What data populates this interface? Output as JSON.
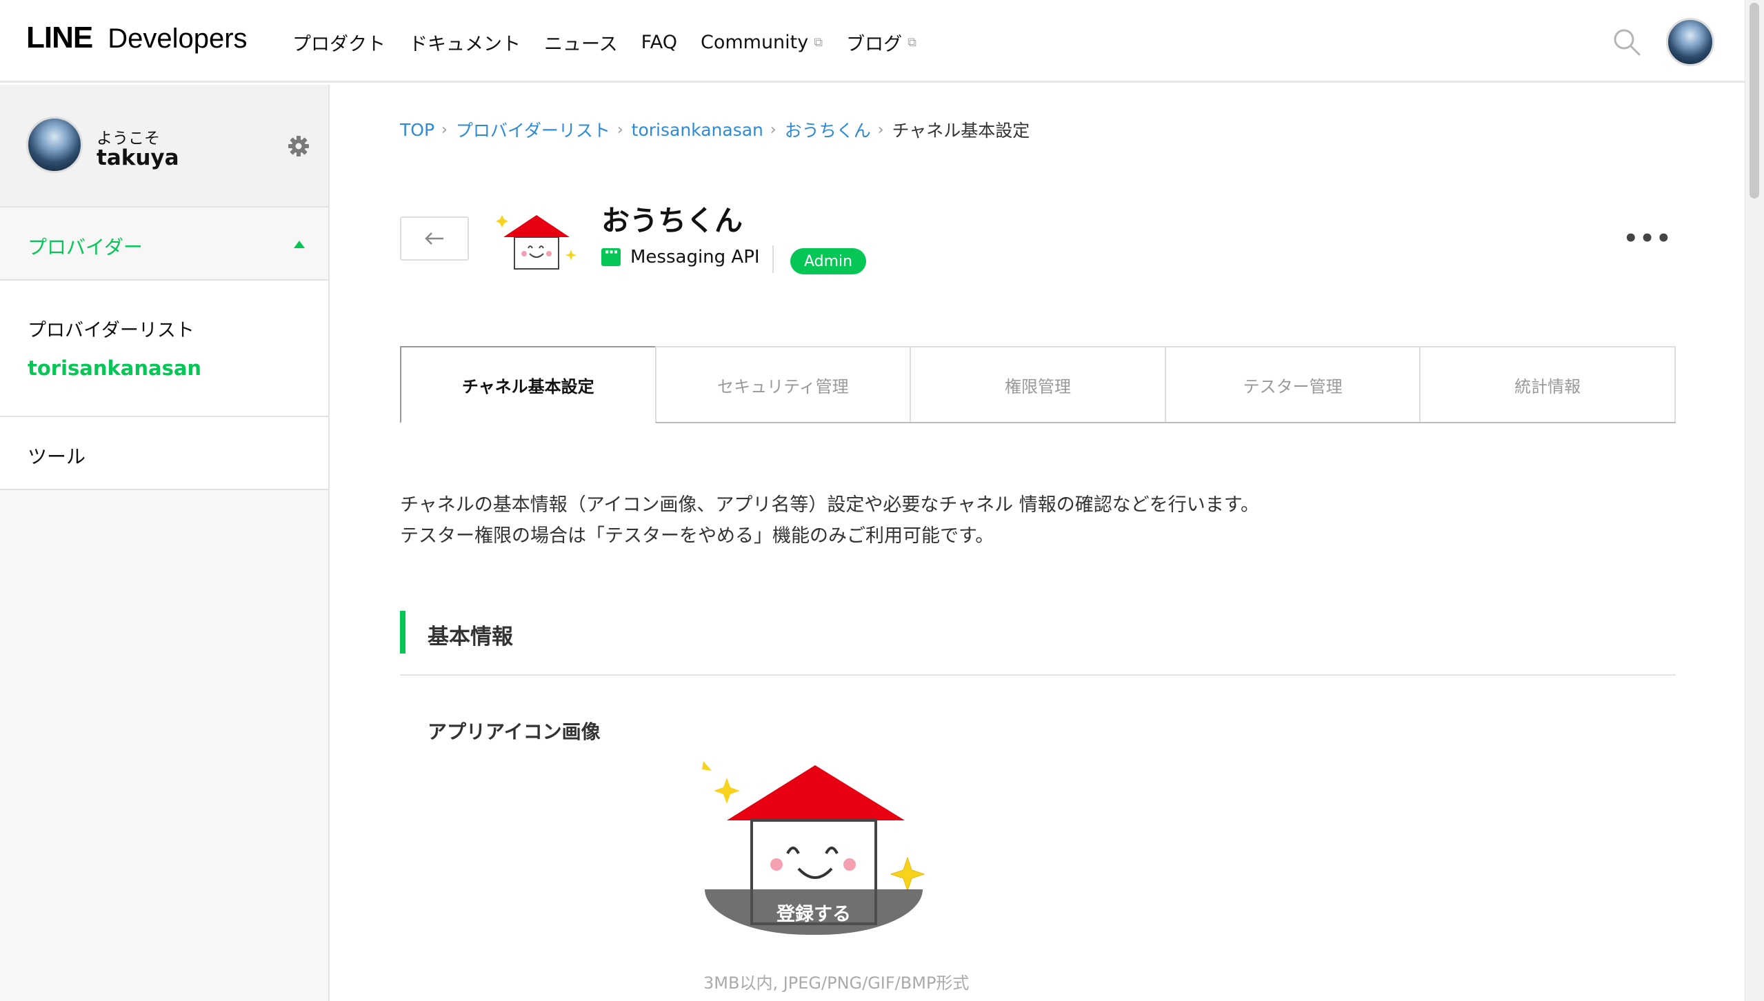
{
  "header": {
    "logo_line": "LINE",
    "logo_developers": "Developers",
    "nav": [
      {
        "label": "プロダクト"
      },
      {
        "label": "ドキュメント"
      },
      {
        "label": "ニュース"
      },
      {
        "label": "FAQ"
      },
      {
        "label": "Community",
        "external": true
      },
      {
        "label": "ブログ",
        "external": true
      }
    ],
    "icons": [
      "search-icon",
      "user-avatar"
    ]
  },
  "sidebar": {
    "welcome_label": "ようこそ",
    "user_name": "takuya",
    "settings_icon": "gear-icon",
    "provider_section_label": "プロバイダー",
    "provider_list_label": "プロバイダーリスト",
    "current_provider": "torisankanasan",
    "tools_label": "ツール"
  },
  "breadcrumb": {
    "items": [
      "TOP",
      "プロバイダーリスト",
      "torisankanasan",
      "おうちくん"
    ],
    "current": "チャネル基本設定"
  },
  "channel": {
    "name": "おうちくん",
    "type": "Messaging API",
    "role_badge": "Admin",
    "more_label": "•••"
  },
  "tabs": [
    {
      "label": "チャネル基本設定",
      "active": true
    },
    {
      "label": "セキュリティ管理",
      "active": false
    },
    {
      "label": "権限管理",
      "active": false
    },
    {
      "label": "テスター管理",
      "active": false
    },
    {
      "label": "統計情報",
      "active": false
    }
  ],
  "description": {
    "line1": "チャネルの基本情報（アイコン画像、アプリ名等）設定や必要なチャネル 情報の確認などを行います。",
    "line2": "テスター権限の場合は「テスターをやめる」機能のみご利用可能です。"
  },
  "basic_info": {
    "section_title": "基本情報",
    "app_icon_label": "アプリアイコン画像",
    "upload_label": "登録する",
    "upload_hint": "3MB以内, JPEG/PNG/GIF/BMP形式"
  },
  "colors": {
    "brand_green": "#06c755",
    "link_blue": "#2d8ad6",
    "house_red": "#e60012"
  }
}
